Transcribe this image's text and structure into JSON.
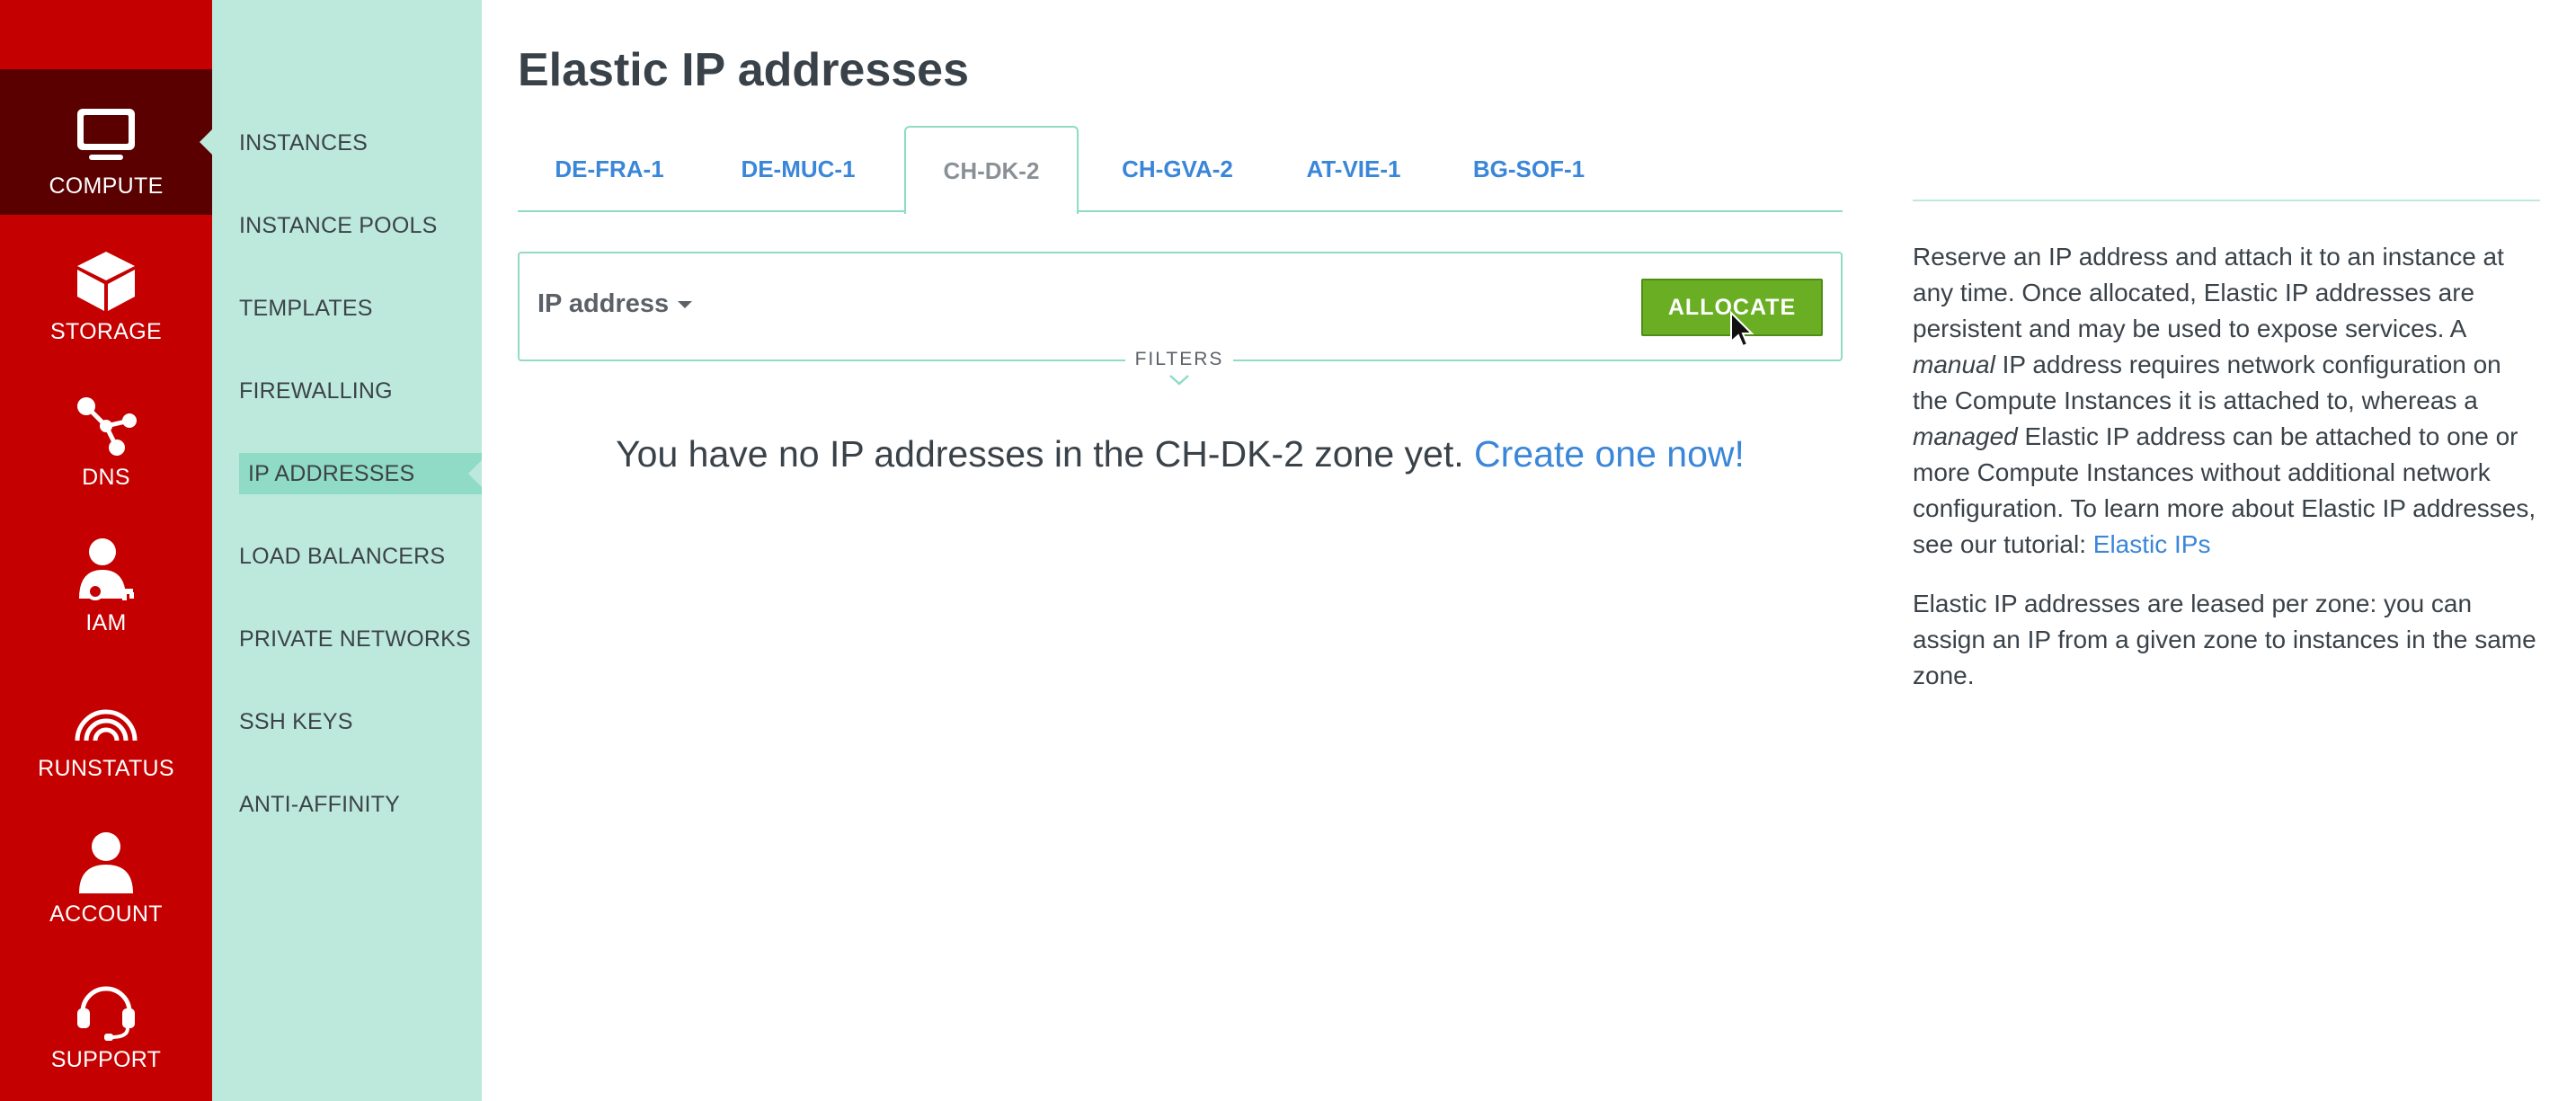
{
  "rail": {
    "items": [
      {
        "label": "COMPUTE",
        "icon": "monitor-icon",
        "active": true
      },
      {
        "label": "STORAGE",
        "icon": "cube-icon"
      },
      {
        "label": "DNS",
        "icon": "network-nodes-icon"
      },
      {
        "label": "IAM",
        "icon": "user-key-icon"
      },
      {
        "label": "RUNSTATUS",
        "icon": "signal-arcs-icon"
      },
      {
        "label": "ACCOUNT",
        "icon": "user-icon"
      },
      {
        "label": "SUPPORT",
        "icon": "headset-icon"
      }
    ]
  },
  "subnav": {
    "items": [
      {
        "label": "INSTANCES"
      },
      {
        "label": "INSTANCE POOLS"
      },
      {
        "label": "TEMPLATES"
      },
      {
        "label": "FIREWALLING"
      },
      {
        "label": "IP ADDRESSES",
        "active": true
      },
      {
        "label": "LOAD BALANCERS"
      },
      {
        "label": "PRIVATE NETWORKS"
      },
      {
        "label": "SSH KEYS"
      },
      {
        "label": "ANTI-AFFINITY"
      }
    ]
  },
  "main": {
    "title": "Elastic IP addresses",
    "tabs": [
      {
        "label": "DE-FRA-1"
      },
      {
        "label": "DE-MUC-1"
      },
      {
        "label": "CH-DK-2",
        "active": true
      },
      {
        "label": "CH-GVA-2"
      },
      {
        "label": "AT-VIE-1"
      },
      {
        "label": "BG-SOF-1"
      }
    ],
    "filter": {
      "select_label": "IP address",
      "allocate_label": "ALLOCATE",
      "filters_label": "FILTERS"
    },
    "empty": {
      "text": "You have no IP addresses in the CH-DK-2 zone yet.",
      "link": "Create one now!"
    }
  },
  "info": {
    "p1_a": "Reserve an IP address and attach it to an instance at any time. Once allocated, Elastic IP addresses are persistent and may be used to expose services. A ",
    "p1_em1": "manual",
    "p1_b": " IP address requires network configuration on the Compute Instances it is attached to, whereas a ",
    "p1_em2": "managed",
    "p1_c": " Elastic IP address can be attached to one or more Compute Instances without additional network configuration. To learn more about Elastic IP addresses, see our tutorial: ",
    "p1_link": "Elastic IPs",
    "p2": "Elastic IP addresses are leased per zone: you can assign an IP from a given zone to instances in the same zone."
  },
  "colors": {
    "rail": "#c50000",
    "rail_active": "#5b0000",
    "subnav": "#bde9dd",
    "subnav_active": "#8fdbc6",
    "link": "#3a86d8",
    "allocate": "#6aaf23"
  }
}
